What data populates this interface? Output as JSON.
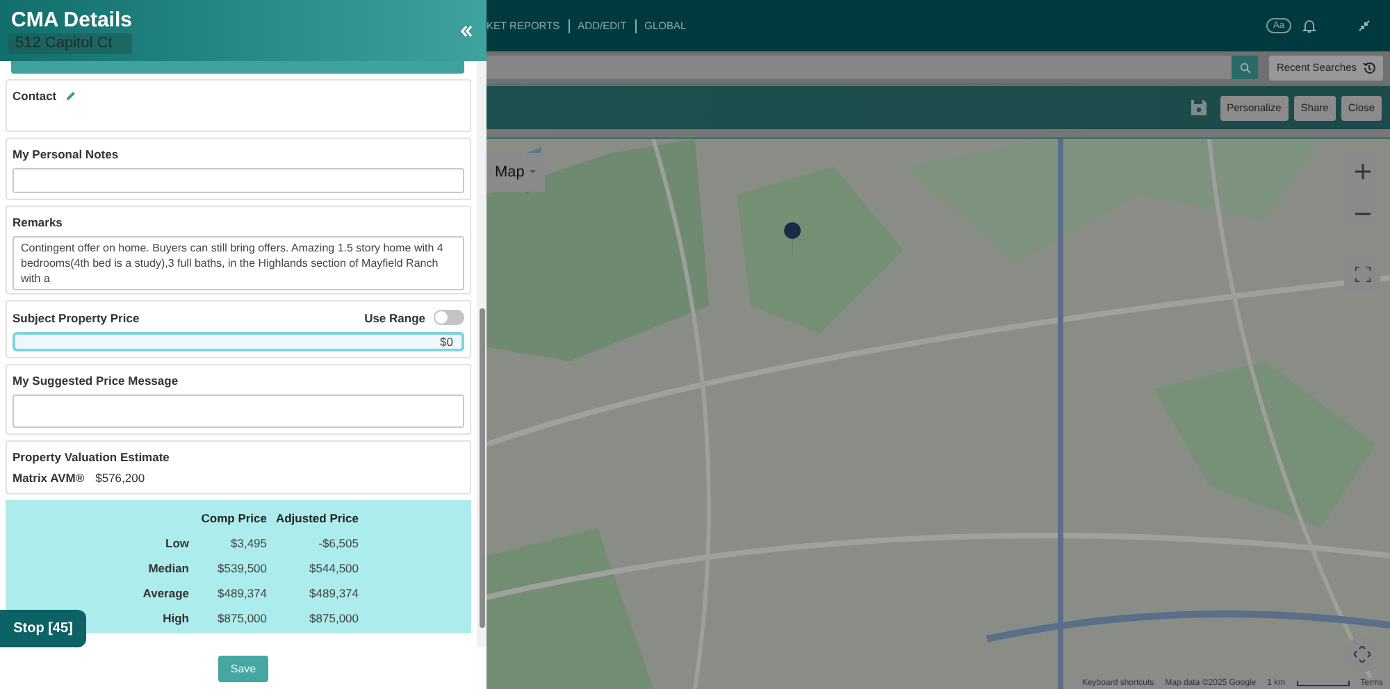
{
  "app": {
    "nav": [
      "KET REPORTS",
      "ADD/EDIT",
      "GLOBAL"
    ],
    "font_size_label": "Aa",
    "recent_searches": "Recent Searches",
    "toolbar_buttons": [
      "Personalize",
      "Share",
      "Close"
    ]
  },
  "map": {
    "type_label": "Map",
    "attribution": [
      "Keyboard shortcuts",
      "Map data ©2025 Google",
      "1 km",
      "Terms"
    ]
  },
  "panel": {
    "title": "CMA Details",
    "subtitle": "512 Capitol Ct"
  },
  "contact": {
    "label": "Contact"
  },
  "personal_notes": {
    "label": "My Personal Notes"
  },
  "remarks": {
    "label": "Remarks",
    "value": "Contingent offer on home. Buyers can still bring offers. Amazing 1.5 story home with 4 bedrooms(4th bed is a study),3 full baths, in the Highlands section of Mayfield Ranch with a"
  },
  "subject_price": {
    "label": "Subject Property Price",
    "use_range_label": "Use Range",
    "use_range_on": false,
    "value": "$0"
  },
  "suggested_message": {
    "label": "My Suggested Price Message"
  },
  "valuation": {
    "label": "Property Valuation Estimate",
    "source": "Matrix AVM®",
    "value": "$576,200"
  },
  "stats": {
    "columns": [
      "Comp Price",
      "Adjusted Price"
    ],
    "rows": [
      {
        "label": "Low",
        "comp": "$3,495",
        "adjusted": "-$6,505"
      },
      {
        "label": "Median",
        "comp": "$539,500",
        "adjusted": "$544,500"
      },
      {
        "label": "Average",
        "comp": "$489,374",
        "adjusted": "$489,374"
      },
      {
        "label": "High",
        "comp": "$875,000",
        "adjusted": "$875,000"
      }
    ]
  },
  "save_button": "Save",
  "stop_button": "Stop [45]"
}
